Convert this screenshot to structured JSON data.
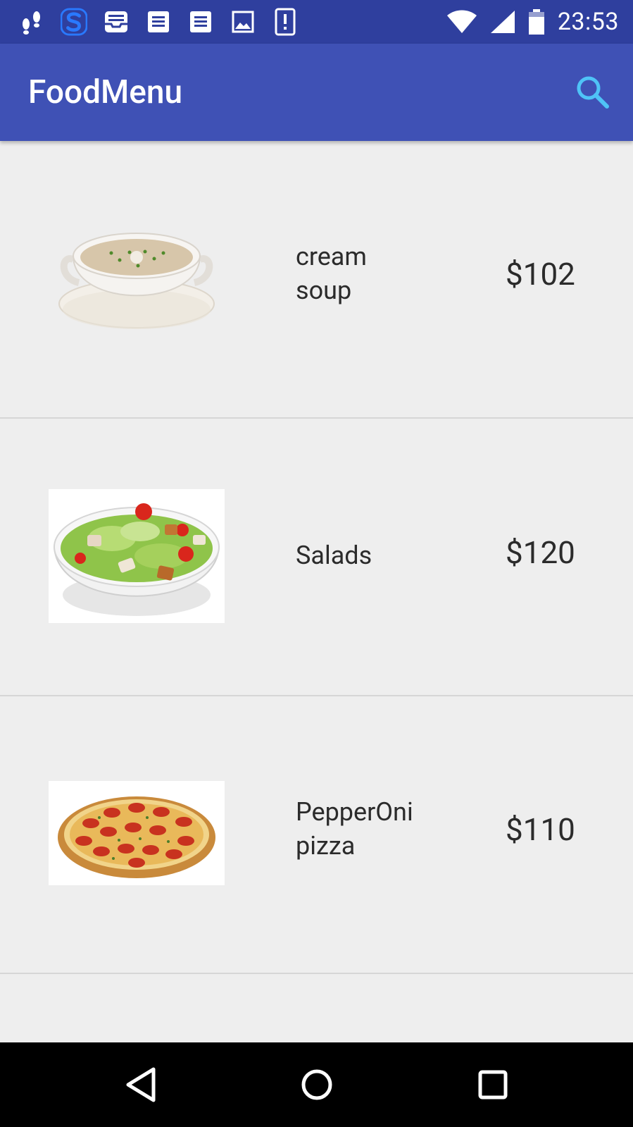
{
  "status_bar": {
    "time": "23:53",
    "left_icons": [
      "footprint-icon",
      "s-app-icon",
      "inbox-icon",
      "document-icon",
      "document-icon",
      "image-icon",
      "alert-icon"
    ],
    "right_icons": [
      "wifi-icon",
      "signal-icon",
      "battery-icon"
    ]
  },
  "app_bar": {
    "title": "FoodMenu",
    "search_icon": "search-icon",
    "accent_color": "#4fc3f7"
  },
  "menu_items": [
    {
      "name": "cream\nsoup",
      "price": "$102",
      "image": "cream-soup-bowl"
    },
    {
      "name": "Salads",
      "price": "$120",
      "image": "salad-bowl"
    },
    {
      "name": "PepperOni\npizza",
      "price": "$110",
      "image": "pepperoni-pizza"
    }
  ],
  "nav_bar": {
    "back_icon": "back-triangle-icon",
    "home_icon": "home-circle-icon",
    "recents_icon": "recents-square-icon"
  },
  "colors": {
    "status_bar": "#2f3f9e",
    "app_bar": "#3f51b5",
    "background": "#eeeeee",
    "divider": "#d6d6d6"
  }
}
